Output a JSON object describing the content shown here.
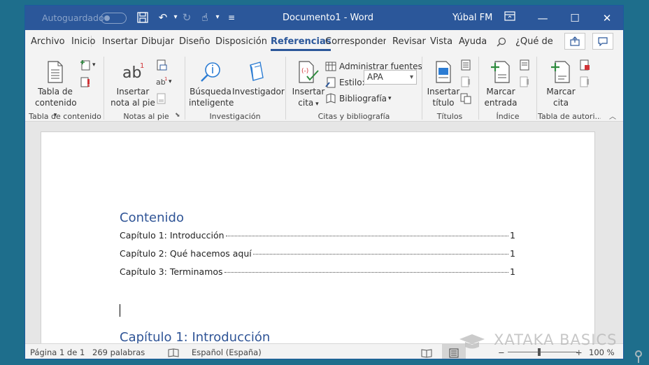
{
  "titlebar": {
    "autosave_label": "Autoguardado",
    "document_title": "Documento1  -  Word",
    "user_name": "Yúbal FM"
  },
  "tabs": [
    "Archivo",
    "Inicio",
    "Insertar",
    "Dibujar",
    "Diseño",
    "Disposición",
    "Referencias",
    "Correspondencias",
    "Revisar",
    "Vista",
    "Ayuda"
  ],
  "active_tab": "Referencias",
  "tell_me": "¿Qué de",
  "ribbon": {
    "toc": {
      "button": "Tabla de\ncontenido",
      "label_line1": "Tabla de",
      "label_line2": "contenido",
      "group": "Tabla de contenido"
    },
    "footnotes": {
      "button_line1": "Insertar",
      "button_line2": "nota al pie",
      "group": "Notas al pie"
    },
    "research": {
      "smart_line1": "Búsqueda",
      "smart_line2": "inteligente",
      "researcher": "Investigador",
      "group": "Investigación"
    },
    "citations": {
      "insert_line1": "Insertar",
      "insert_line2": "cita",
      "manage": "Administrar fuentes",
      "style_label": "Estilo:",
      "style_value": "APA",
      "bibliography": "Bibliografía",
      "group": "Citas y bibliografía"
    },
    "captions": {
      "line1": "Insertar",
      "line2": "título",
      "group": "Títulos"
    },
    "index": {
      "line1": "Marcar",
      "line2": "entrada",
      "group": "Índice"
    },
    "authorities": {
      "line1": "Marcar",
      "line2": "cita",
      "group": "Tabla de autori..."
    }
  },
  "document": {
    "toc_title": "Contenido",
    "toc_entries": [
      {
        "label": "Capítulo 1: Introducción",
        "page": "1"
      },
      {
        "label": "Capítulo 2: Qué hacemos aquí",
        "page": "1"
      },
      {
        "label": "Capítulo 3: Terminamos",
        "page": "1"
      }
    ],
    "heading1": "Capítulo 1: Introducción"
  },
  "status": {
    "page": "Página 1 de 1",
    "words": "269 palabras",
    "language": "Español (España)",
    "zoom": "100 %"
  },
  "watermark": "XATAKA BASICS",
  "colors": {
    "titlebar": "#2b579a",
    "heading": "#2f5496"
  }
}
